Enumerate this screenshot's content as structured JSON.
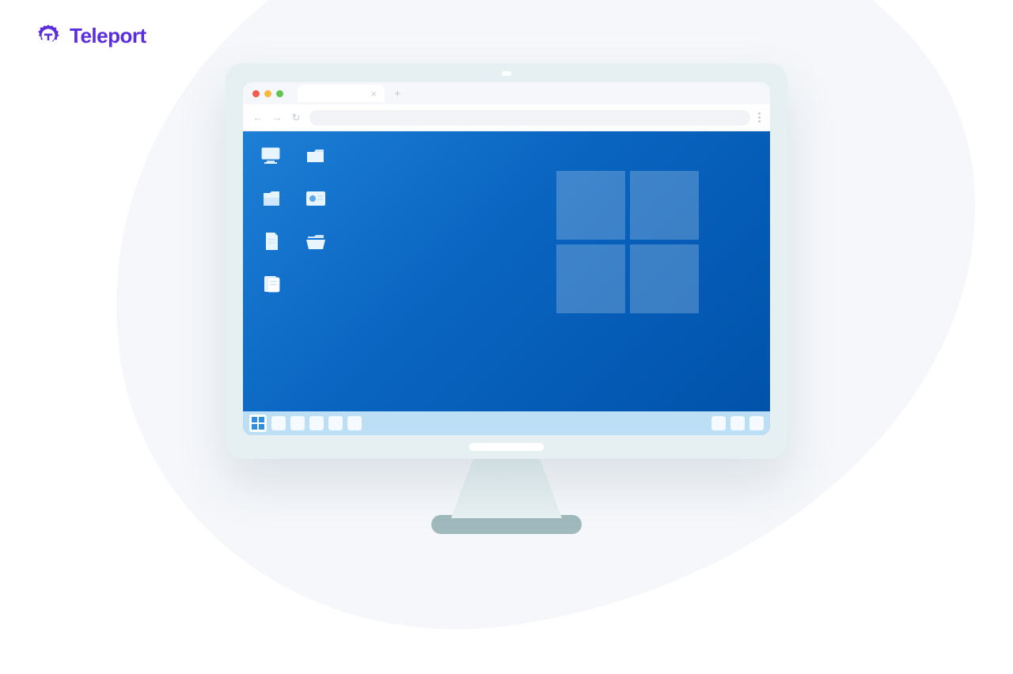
{
  "brand": {
    "name": "Teleport",
    "color": "#5a2de0"
  },
  "browser": {
    "traffic": [
      "close",
      "minimize",
      "maximize"
    ],
    "tab_close_glyph": "×",
    "new_tab_glyph": "+",
    "nav": {
      "back": "←",
      "forward": "→",
      "reload": "↻"
    },
    "menu_label": "menu"
  },
  "remote_desktop": {
    "os": "Windows",
    "wallpaper_logo": "windows-logo",
    "icons": [
      {
        "name": "this-pc-icon"
      },
      {
        "name": "folder-icon"
      },
      {
        "name": "file-explorer-icon"
      },
      {
        "name": "control-panel-icon"
      },
      {
        "name": "document-icon"
      },
      {
        "name": "folder-open-icon"
      },
      {
        "name": "notes-icon"
      }
    ],
    "taskbar": {
      "start": "start",
      "pinned_count": 5,
      "tray_count": 3
    }
  }
}
